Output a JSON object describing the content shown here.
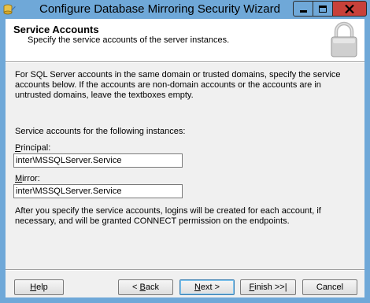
{
  "window": {
    "title": "Configure Database Mirroring Security Wizard",
    "icon": "database-wizard-icon",
    "title_bar_color": "#6fa8d8",
    "close_button_color": "#c8413a"
  },
  "header": {
    "title": "Service Accounts",
    "subtitle": "Specify the service accounts of the server instances.",
    "icon": "lock-icon"
  },
  "body": {
    "intro": "For SQL Server accounts in the same domain or trusted domains, specify the service accounts below. If the accounts are non-domain accounts or the accounts are in untrusted domains, leave the textboxes empty.",
    "instances_label": "Service accounts for the following instances:",
    "principal": {
      "label_mnemonic": "P",
      "label_rest": "rincipal:",
      "value": "inter\\MSSQLServer.Service"
    },
    "mirror": {
      "label_mnemonic": "M",
      "label_rest": "irror:",
      "value": "inter\\MSSQLServer.Service"
    },
    "after_text": "After you specify the service accounts, logins will be created for each account, if necessary, and will be granted CONNECT permission on the endpoints."
  },
  "buttons": {
    "help": {
      "mnemonic": "H",
      "rest": "elp"
    },
    "back": {
      "prefix": "< ",
      "mnemonic": "B",
      "rest": "ack"
    },
    "next": {
      "mnemonic": "N",
      "rest": "ext >"
    },
    "finish": {
      "mnemonic": "F",
      "rest": "inish >>|"
    },
    "cancel": {
      "label": "Cancel"
    }
  }
}
